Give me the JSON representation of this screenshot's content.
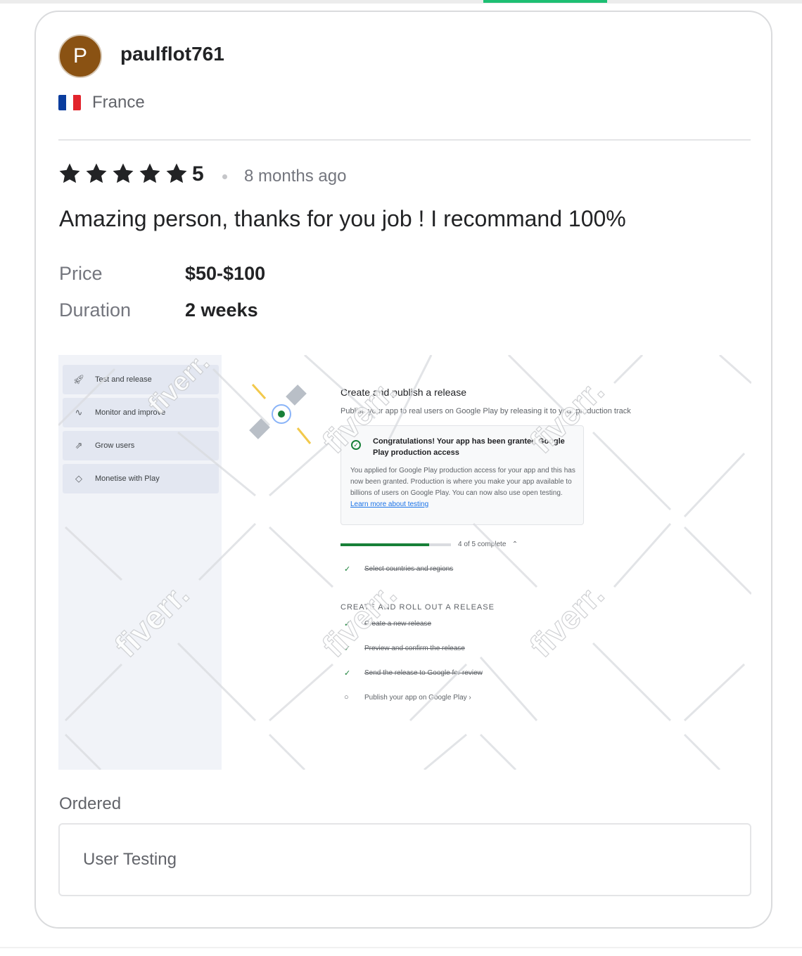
{
  "reviewer": {
    "avatar_initial": "P",
    "username": "paulflot761",
    "country": "France",
    "avatar_color": "#8a5213"
  },
  "review": {
    "stars": 5,
    "rating": "5",
    "time_ago": "8 months ago",
    "text": "Amazing person, thanks for you job ! I recommand 100%"
  },
  "meta": {
    "price_label": "Price",
    "price_value": "$50-$100",
    "duration_label": "Duration",
    "duration_value": "2 weeks"
  },
  "screenshot": {
    "nav": [
      {
        "icon": "rocket-icon",
        "label": "Test and release"
      },
      {
        "icon": "pulse-icon",
        "label": "Monitor and improve"
      },
      {
        "icon": "growth-icon",
        "label": "Grow users"
      },
      {
        "icon": "tag-icon",
        "label": "Monetise with Play"
      }
    ],
    "title": "Create and publish a release",
    "subtitle": "Publish your app to real users on Google Play by releasing it to your production track",
    "congrats_title": "Congratulations! Your app has been granted Google Play production access",
    "congrats_body": "You applied for Google Play production access for your app and this has now been granted. Production is where you make your app available to billions of users on Google Play. You can now also use open testing.",
    "congrats_link": "Learn more about testing",
    "progress_text": "4 of 5 complete",
    "progress_fraction": 0.8,
    "step_first": "Select countries and regions",
    "section_heading": "CREATE AND ROLL OUT A RELEASE",
    "steps": [
      {
        "label": "Create a new release",
        "done": true
      },
      {
        "label": "Preview and confirm the release",
        "done": true
      },
      {
        "label": "Send the release to Google for review",
        "done": true
      },
      {
        "label": "Publish your app on Google Play ›",
        "done": false
      }
    ],
    "watermark": "fiverr."
  },
  "ordered": {
    "label": "Ordered",
    "value": "User Testing"
  },
  "colors": {
    "accent_green": "#1dbf73",
    "star": "#222325",
    "play_green": "#188038",
    "link_blue": "#1a73e8"
  }
}
